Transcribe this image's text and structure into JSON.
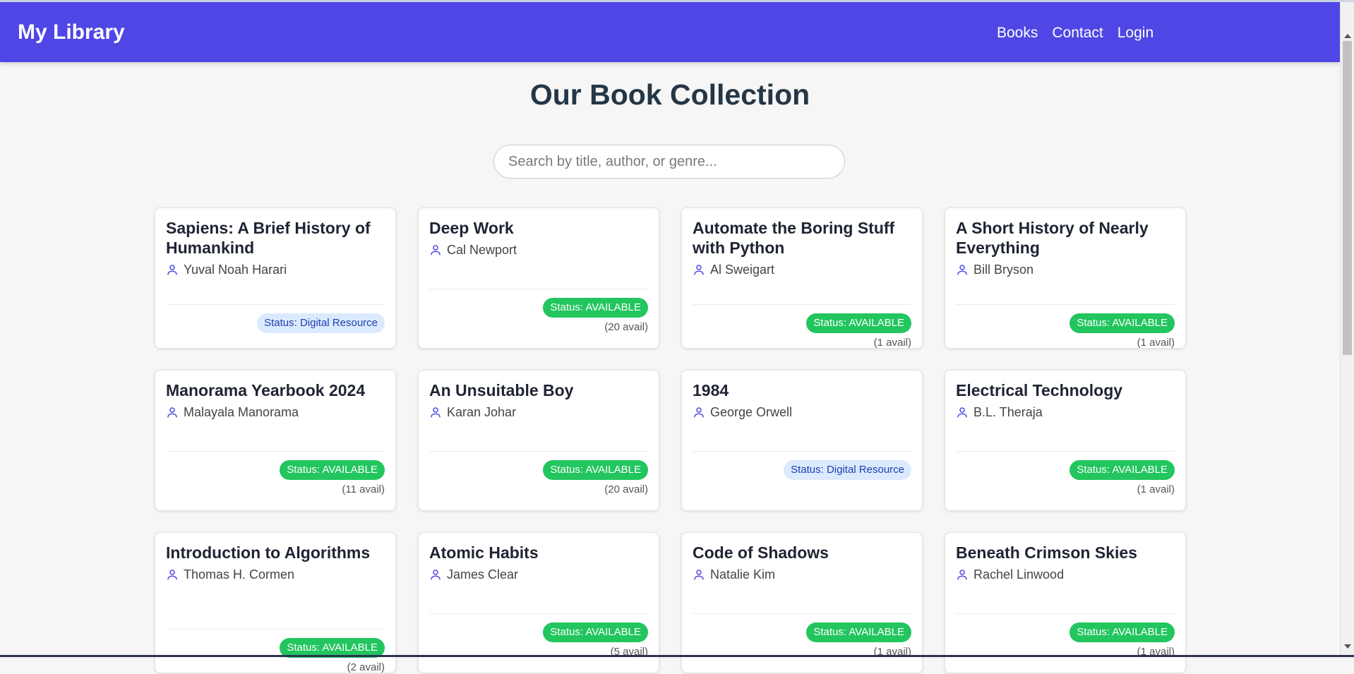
{
  "navbar": {
    "brand": "My Library",
    "links": [
      "Books",
      "Contact",
      "Login"
    ]
  },
  "page": {
    "title": "Our Book Collection"
  },
  "search": {
    "placeholder": "Search by title, author, or genre...",
    "value": ""
  },
  "books": [
    {
      "title": "Sapiens: A Brief History of Humankind",
      "author": "Yuval Noah Harari",
      "status": "Status: Digital Resource",
      "kind": "digital",
      "avail": ""
    },
    {
      "title": "Deep Work",
      "author": "Cal Newport",
      "status": "Status: AVAILABLE",
      "kind": "available",
      "avail": "(20 avail)"
    },
    {
      "title": "Automate the Boring Stuff with Python",
      "author": "Al Sweigart",
      "status": "Status: AVAILABLE",
      "kind": "available",
      "avail": "(1 avail)"
    },
    {
      "title": "A Short History of Nearly Everything",
      "author": "Bill Bryson",
      "status": "Status: AVAILABLE",
      "kind": "available",
      "avail": "(1 avail)"
    },
    {
      "title": "Manorama Yearbook 2024",
      "author": "Malayala Manorama",
      "status": "Status: AVAILABLE",
      "kind": "available",
      "avail": "(11 avail)"
    },
    {
      "title": "An Unsuitable Boy",
      "author": "Karan Johar",
      "status": "Status: AVAILABLE",
      "kind": "available",
      "avail": "(20 avail)"
    },
    {
      "title": "1984",
      "author": "George Orwell",
      "status": "Status: Digital Resource",
      "kind": "digital",
      "avail": ""
    },
    {
      "title": "Electrical Technology",
      "author": "B.L. Theraja",
      "status": "Status: AVAILABLE",
      "kind": "available",
      "avail": "(1 avail)"
    },
    {
      "title": "Introduction to Algorithms",
      "author": "Thomas H. Cormen",
      "status": "Status: AVAILABLE",
      "kind": "available",
      "avail": "(2 avail)"
    },
    {
      "title": "Atomic Habits",
      "author": "James Clear",
      "status": "Status: AVAILABLE",
      "kind": "available",
      "avail": "(5 avail)"
    },
    {
      "title": "Code of Shadows",
      "author": "Natalie Kim",
      "status": "Status: AVAILABLE",
      "kind": "available",
      "avail": "(1 avail)"
    },
    {
      "title": "Beneath Crimson Skies",
      "author": "Rachel Linwood",
      "status": "Status: AVAILABLE",
      "kind": "available",
      "avail": "(1 avail)"
    }
  ],
  "colors": {
    "navbar": "#4f46e5",
    "available_badge": "#22c55e",
    "digital_badge": "#dbeafe",
    "title_text": "#253746"
  }
}
